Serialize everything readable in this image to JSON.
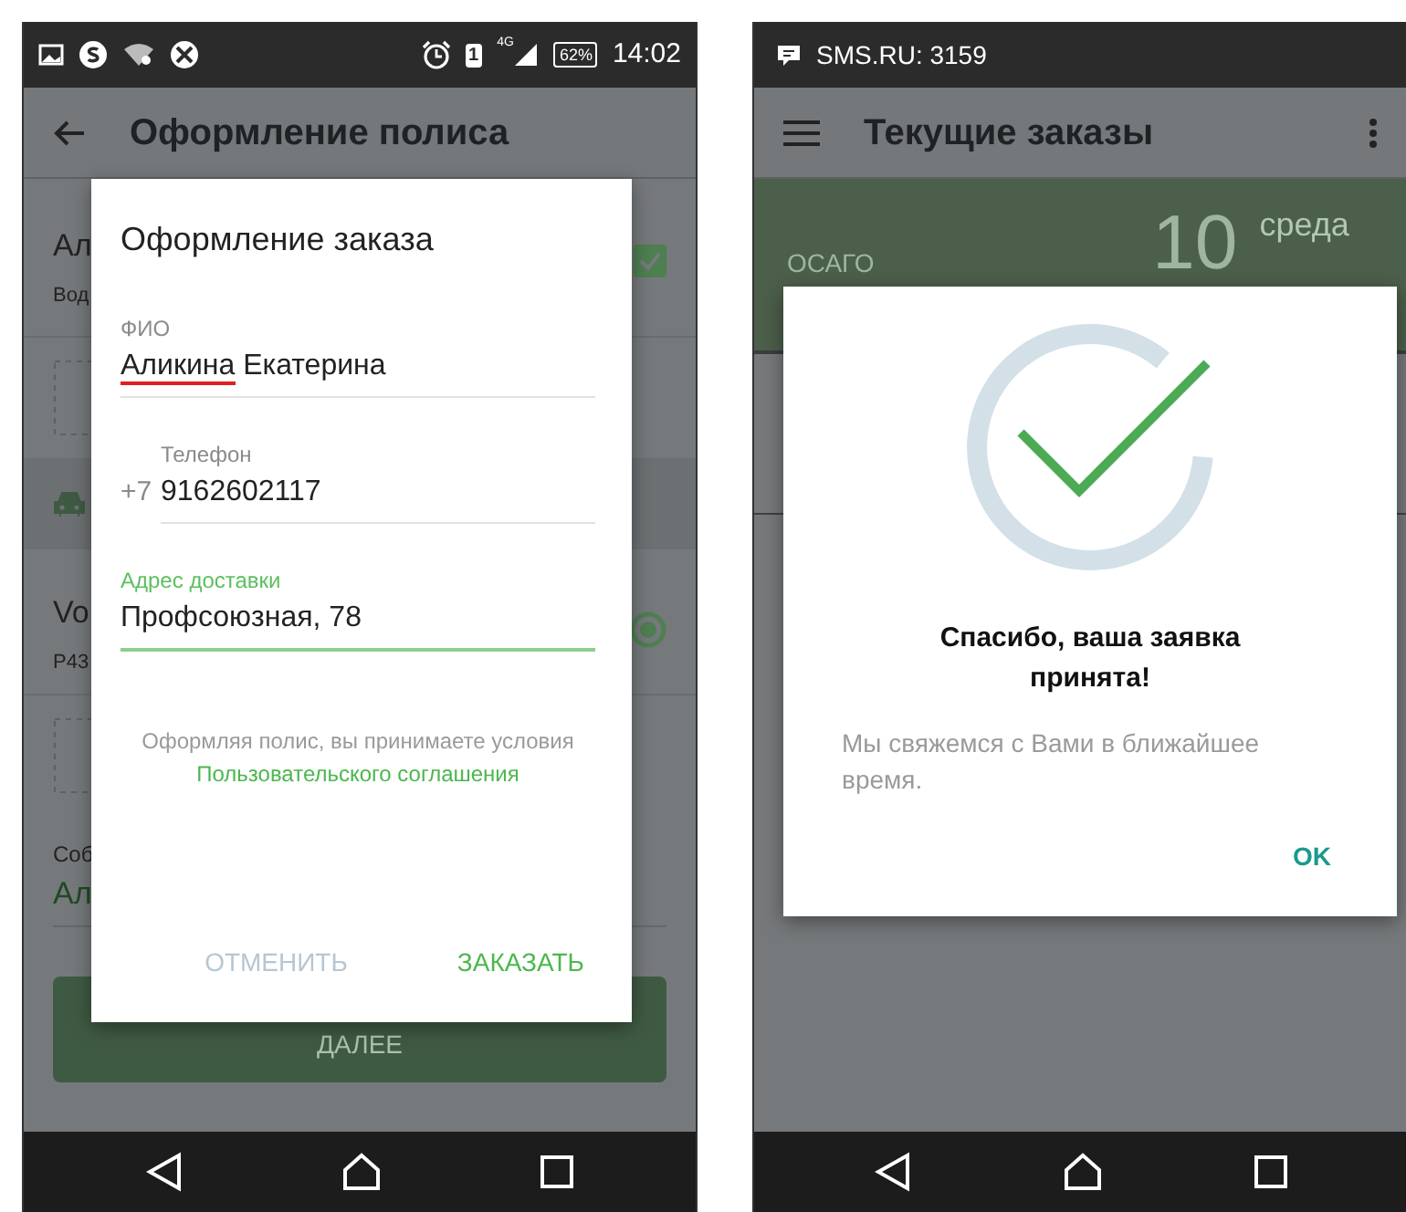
{
  "left_phone": {
    "status_bar": {
      "sim": "1",
      "network": "4G",
      "battery": "62%",
      "time": "14:02"
    },
    "app_bar": {
      "title": "Оформление полиса"
    },
    "background": {
      "owner": {
        "name": "Ал",
        "detail": "Вод",
        "checked": true
      },
      "vehicle": {
        "name": "Vo",
        "detail": "Р43",
        "selected": true
      },
      "owner_field": {
        "label": "Соб",
        "value": "Ал"
      },
      "next_button": "ДАЛЕЕ"
    },
    "dialog": {
      "title": "Оформление заказа",
      "fields": [
        {
          "label": "ФИО",
          "value": "Аликина Екатерина",
          "focused": false,
          "spell_error": true
        },
        {
          "label": "Телефон",
          "prefix": "+7",
          "value": "9162602117",
          "focused": false,
          "spell_error": false
        },
        {
          "label": "Адрес доставки",
          "value": "Профсоюзная, 78",
          "focused": true,
          "spell_error": false
        }
      ],
      "agreement": {
        "text": "Оформляя полис, вы принимаете условия",
        "link": "Пользовательского соглашения"
      },
      "buttons": [
        {
          "label": "ОТМЕНИТЬ",
          "disabled": true
        },
        {
          "label": "ЗАКАЗАТЬ",
          "disabled": false
        }
      ]
    }
  },
  "right_phone": {
    "status_bar": {
      "notification": "SMS.RU: 3159"
    },
    "app_bar": {
      "title": "Текущие заказы"
    },
    "order_card": {
      "type": "ОСАГО",
      "day": "10",
      "weekday": "среда"
    },
    "dialog": {
      "title": "Спасибо, ваша заявка принята!",
      "message": "Мы свяжемся с Вами в ближайшее время.",
      "button": "OK"
    }
  }
}
